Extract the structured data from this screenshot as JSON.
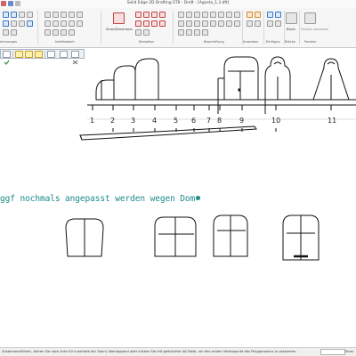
{
  "window": {
    "title": "Solid Edge 2D Drafting ST8 - Draft - [Agosta_1,3.dft]"
  },
  "ribbon": {
    "groups": [
      {
        "label": "ehmungen"
      },
      {
        "label": "Intellisketch"
      },
      {
        "label": "Bemaßen"
      },
      {
        "label": "Beschriftung"
      },
      {
        "label": "Anordnen"
      },
      {
        "label": "Einfügen"
      },
      {
        "label": "Blöcke"
      },
      {
        "label": "Fenster"
      }
    ],
    "smart_dimension_label": "SmartDimension",
    "block_label": "Block",
    "window_button_label": "Fenster wechseln"
  },
  "annotation_text": "ggf nochmals angepasst werden wegen Dom",
  "ruler": {
    "ticks": [
      "1",
      "2",
      "3",
      "4",
      "5",
      "6",
      "7",
      "8",
      "9",
      "10",
      "11"
    ]
  },
  "status": {
    "message": "Zusammenführen, ziehen Sie nach links für innerhalb der Zaun) überlappend oder klicken Sie mit gedrückter Alt-Taste, um den ersten Vertexpunkt des Polygonzauns zu platzieren.",
    "right_text": "Einst."
  }
}
